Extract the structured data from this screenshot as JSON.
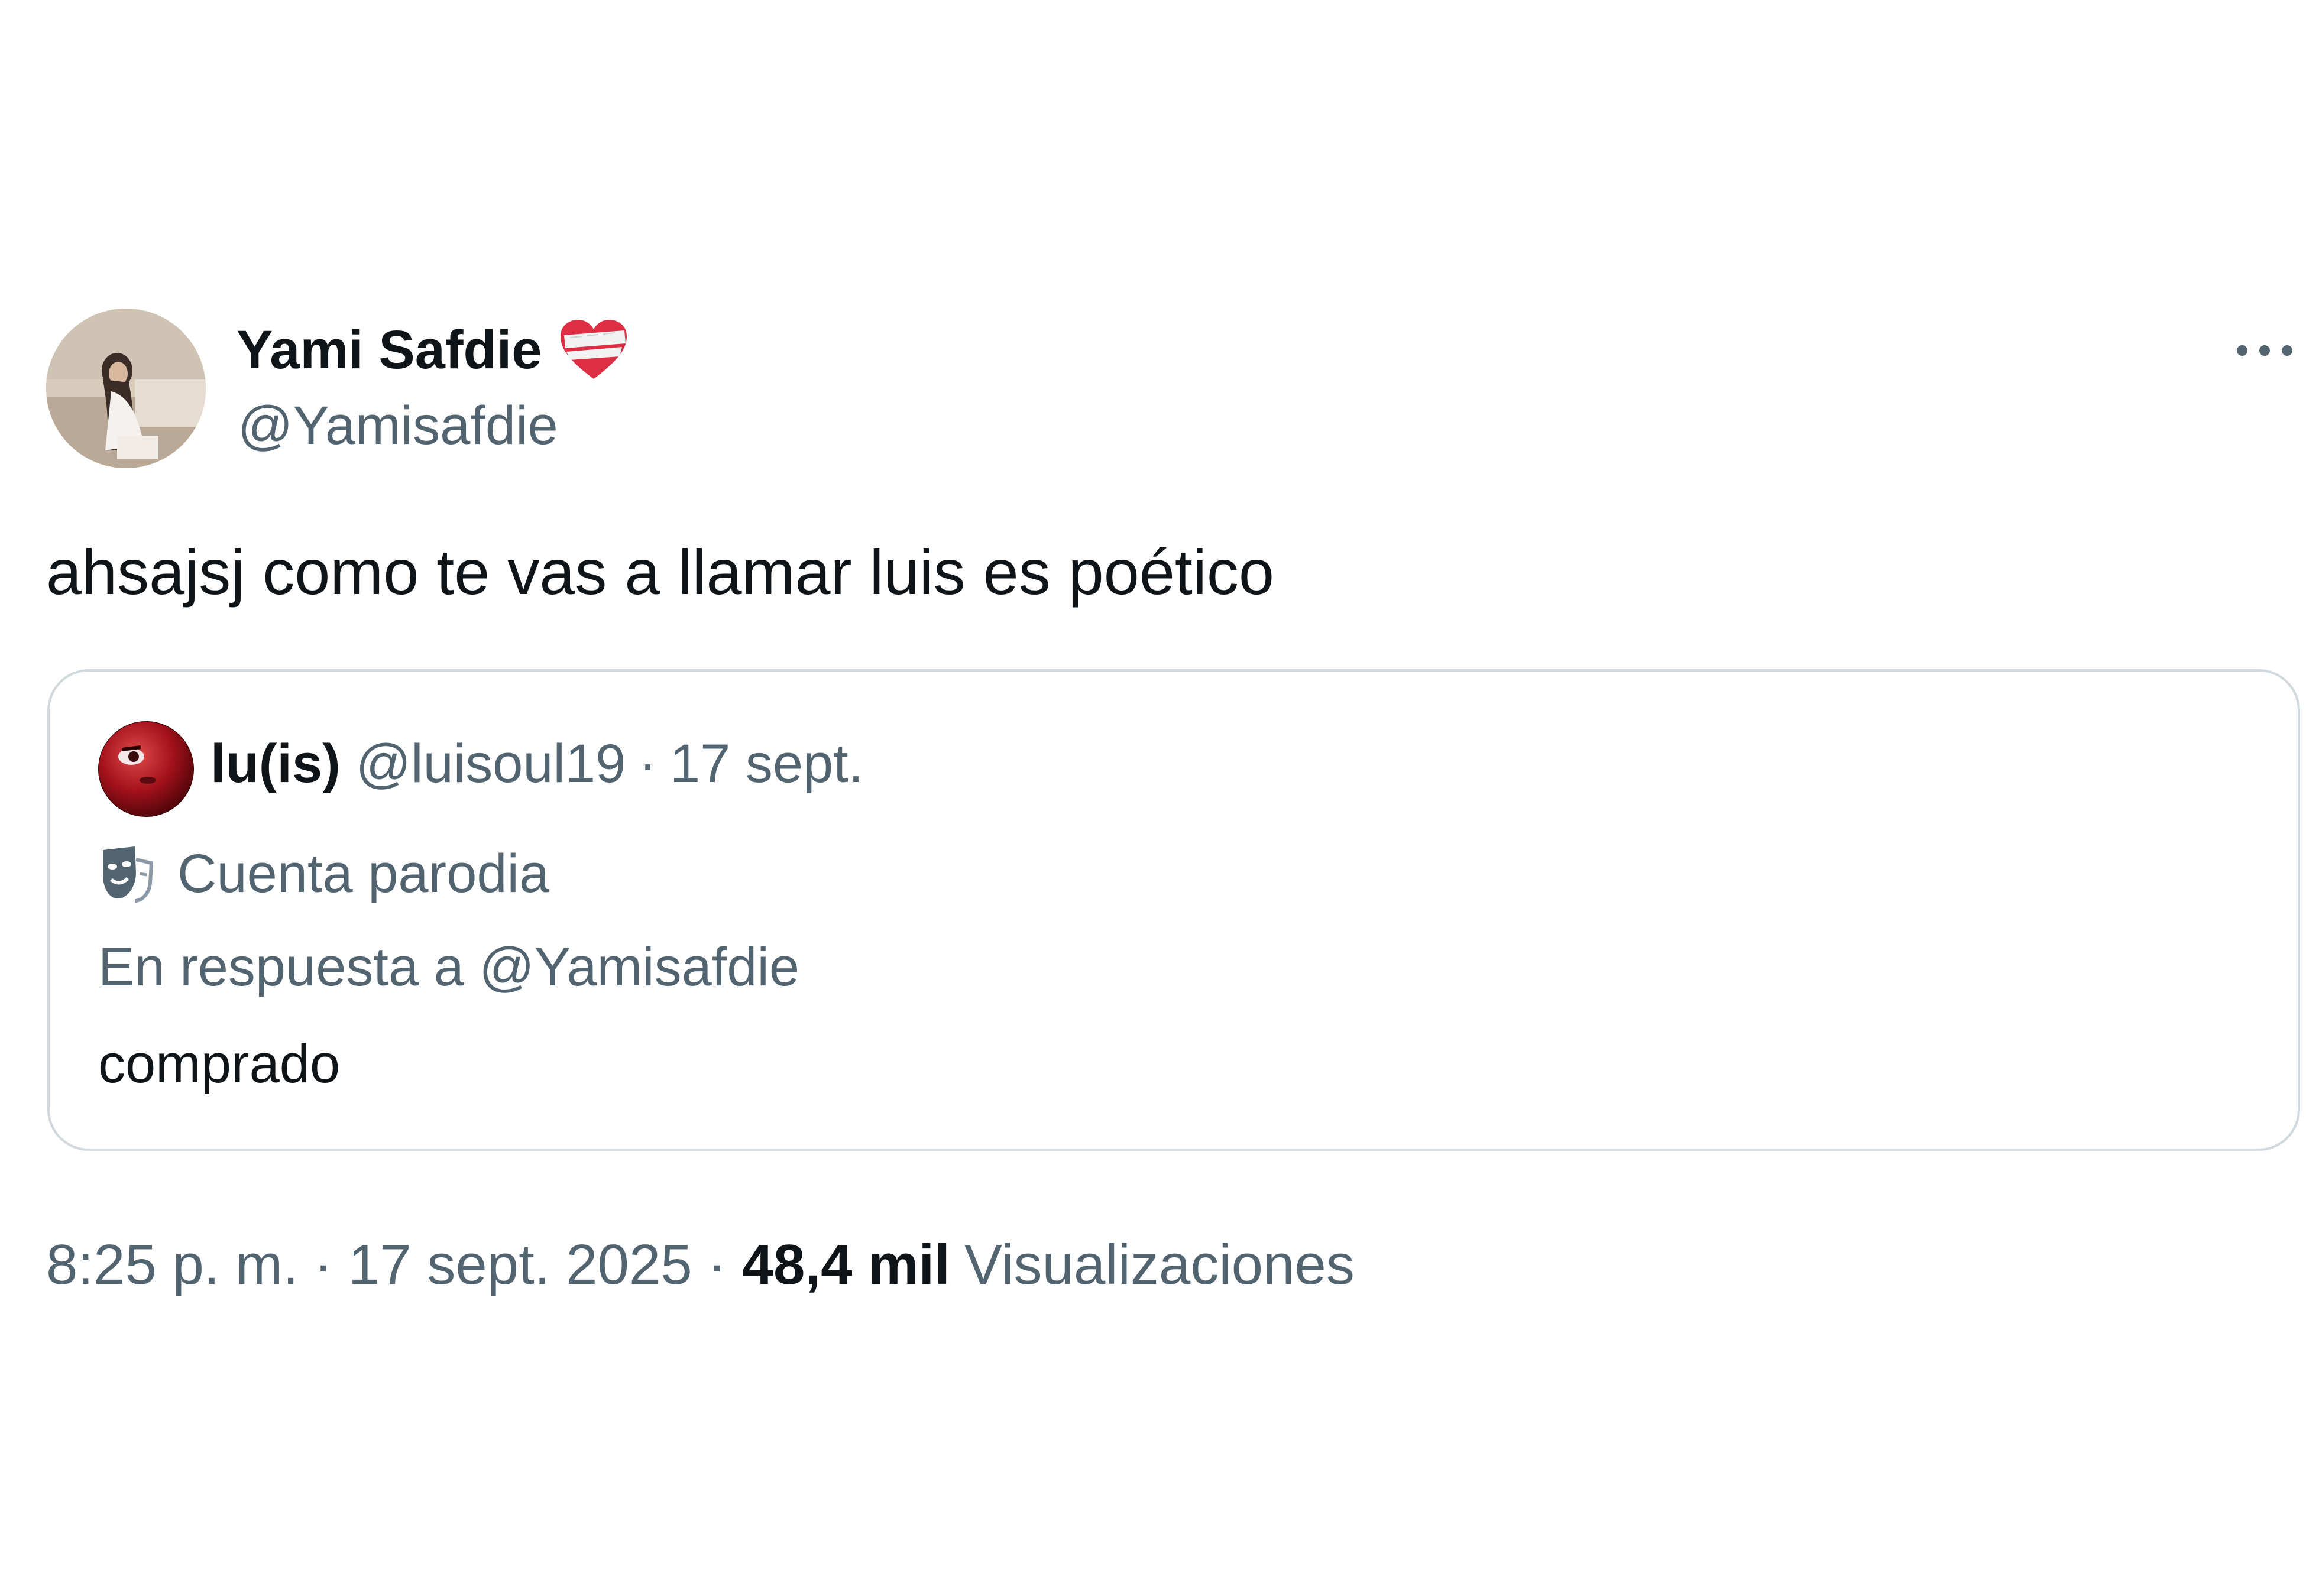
{
  "tweet": {
    "author": {
      "name": "Yami Safdie",
      "handle": "@Yamisafdie",
      "badge_icon": "heart-bandage-emoji"
    },
    "text": "ahsajsj como te vas a llamar luis es poético",
    "more_icon": "more-horizontal-icon",
    "quote": {
      "name": "lu(is)",
      "handle": "@luisoul19",
      "separator": "·",
      "date": "17 sept.",
      "parody_icon": "theater-mask-icon",
      "parody_label": "Cuenta parodia",
      "reply_to": "En respuesta a @Yamisafdie",
      "text": "comprado"
    },
    "meta": {
      "time": "8:25 p. m.",
      "separator": "·",
      "date": "17 sept. 2025",
      "views_count": "48,4 mil",
      "views_label": "Visualizaciones"
    },
    "colors": {
      "primary_text": "#0f1419",
      "secondary_text": "#536471",
      "border": "#cfd9de"
    }
  }
}
